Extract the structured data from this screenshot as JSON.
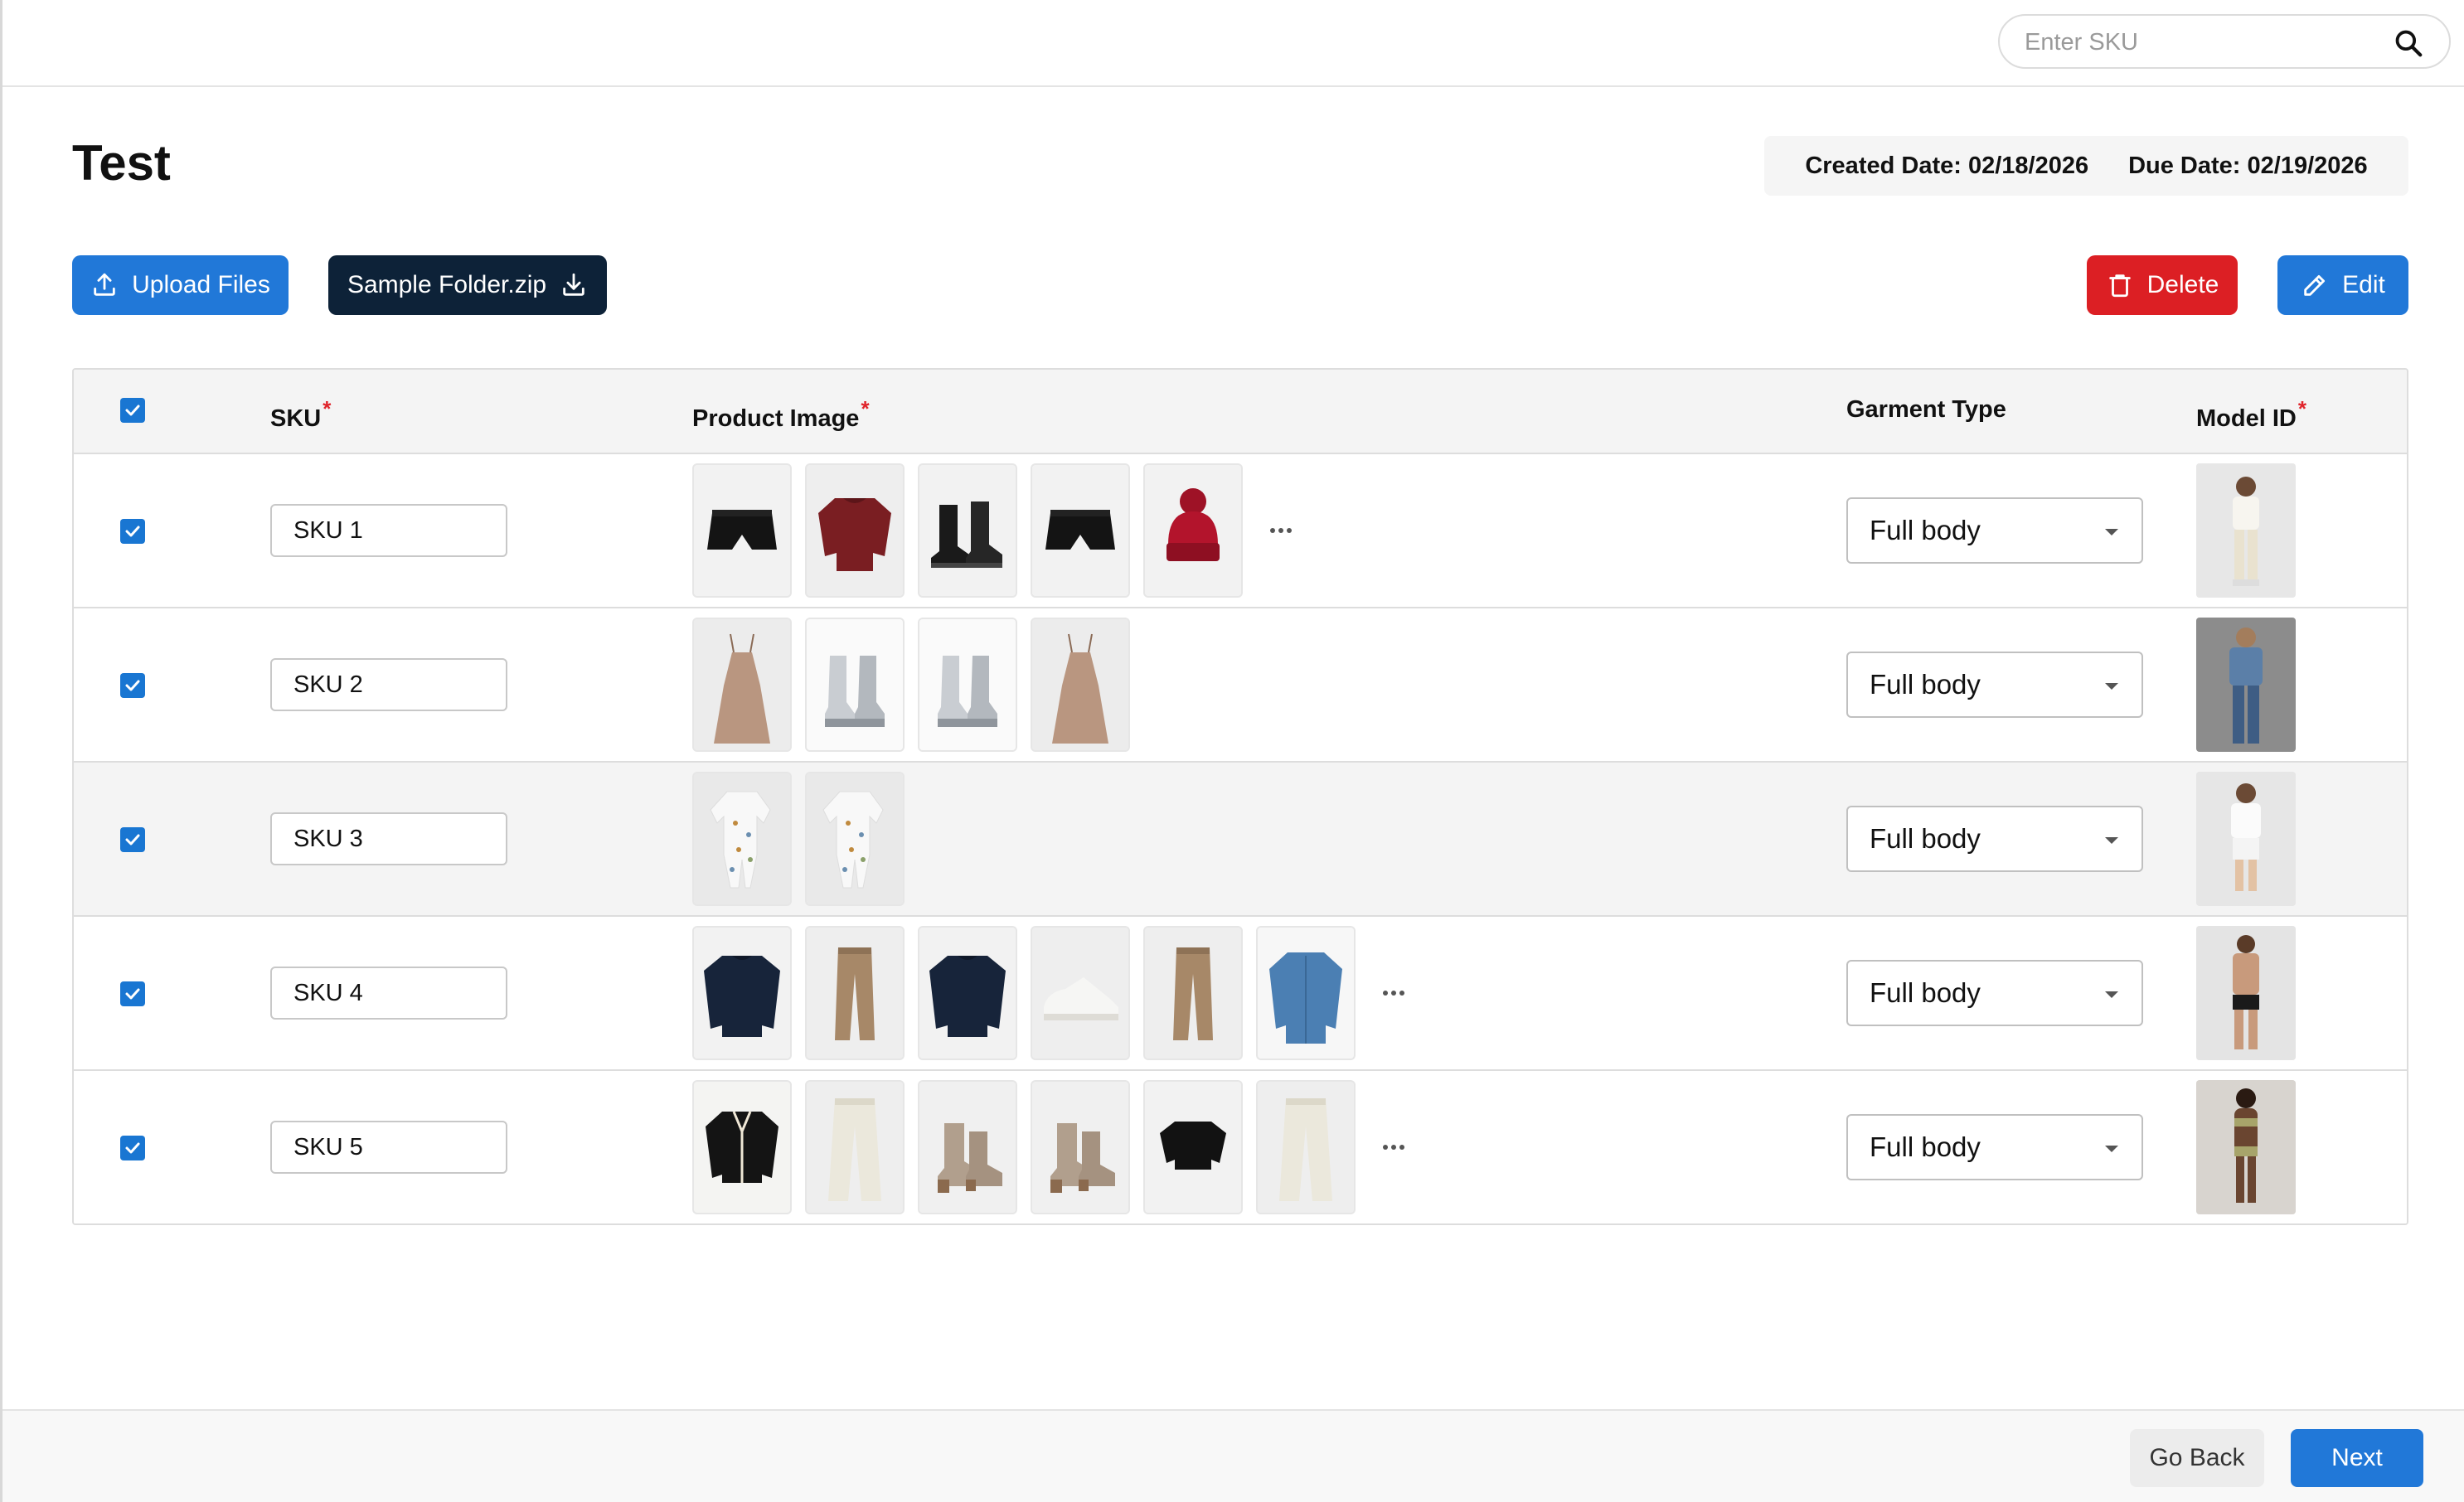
{
  "search": {
    "placeholder": "Enter SKU"
  },
  "page": {
    "title": "Test",
    "created_date": "Created Date: 02/18/2026",
    "due_date": "Due Date: 02/19/2026"
  },
  "toolbar": {
    "upload_label": "Upload Files",
    "sample_label": "Sample Folder.zip",
    "delete_label": "Delete",
    "edit_label": "Edit"
  },
  "table": {
    "headers": {
      "sku": "SKU",
      "product_image": "Product Image",
      "garment_type": "Garment Type",
      "model_id": "Model ID",
      "required_mark": "*"
    },
    "rows": [
      {
        "sku": "SKU 1",
        "garment_type": "Full body",
        "images": [
          "black-shorts",
          "maroon-sweater",
          "black-boots",
          "black-shorts",
          "red-beanie"
        ],
        "more": true,
        "model": "child-white-outfit"
      },
      {
        "sku": "SKU 2",
        "garment_type": "Full body",
        "images": [
          "tan-slip-dress",
          "silver-boots",
          "silver-boots",
          "tan-slip-dress"
        ],
        "more": false,
        "model": "woman-denim"
      },
      {
        "sku": "SKU 3",
        "garment_type": "Full body",
        "images": [
          "printed-romper",
          "printed-romper"
        ],
        "more": false,
        "model": "child-white-shorts"
      },
      {
        "sku": "SKU 4",
        "garment_type": "Full body",
        "images": [
          "navy-sweater",
          "khaki-pants",
          "navy-sweater",
          "white-sneaker",
          "khaki-pants",
          "denim-shirt"
        ],
        "more": true,
        "model": "man-underwear"
      },
      {
        "sku": "SKU 5",
        "garment_type": "Full body",
        "images": [
          "black-cardigan",
          "cream-pants",
          "taupe-boots",
          "taupe-boots",
          "black-crop-top",
          "cream-pants"
        ],
        "more": true,
        "model": "woman-swimwear"
      }
    ]
  },
  "footer": {
    "back_label": "Go Back",
    "next_label": "Next"
  },
  "colors": {
    "primary": "#2178d8",
    "dark": "#0d2238",
    "danger": "#dc1f24",
    "required": "#e0242b"
  }
}
